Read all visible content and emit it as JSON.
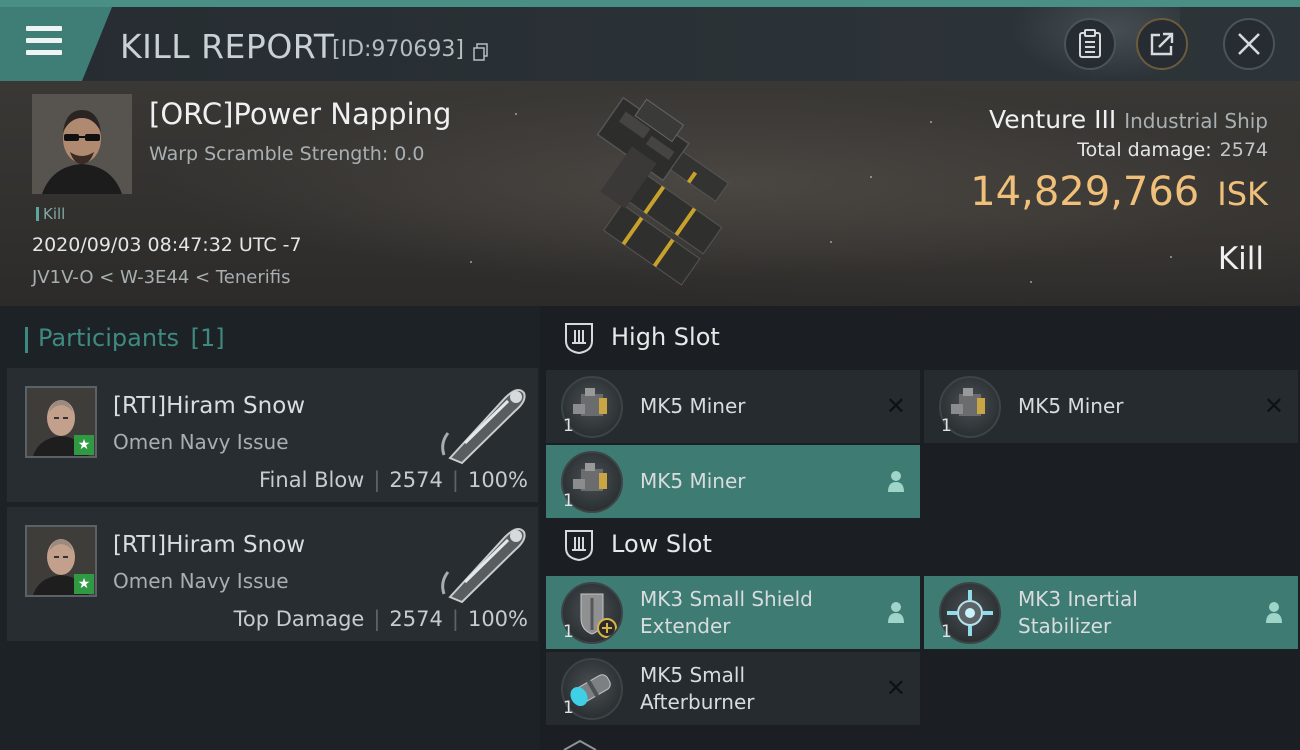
{
  "header": {
    "title": "KILL REPORT",
    "report_id": "[ID:970693]",
    "buttons": [
      "clipboard-icon",
      "share-icon",
      "close-icon"
    ]
  },
  "victim": {
    "name": "[ORC]Power Napping",
    "warp_scramble": "Warp Scramble Strength: 0.0",
    "tag": "Kill",
    "datetime": "2020/09/03 08:47:32 UTC -7",
    "location": "JV1V-O < W-3E44 < Tenerifis"
  },
  "ship": {
    "name": "Venture III",
    "class": "Industrial Ship",
    "total_damage_label": "Total damage:",
    "total_damage": "2574",
    "isk_value": "14,829,766",
    "isk_unit": "ISK",
    "result": "Kill"
  },
  "participants": {
    "label": "Participants",
    "count": "[1]",
    "items": [
      {
        "name": "[RTI]Hiram Snow",
        "ship": "Omen Navy Issue",
        "role": "Final Blow",
        "damage": "2574",
        "percent": "100%"
      },
      {
        "name": "[RTI]Hiram Snow",
        "ship": "Omen Navy Issue",
        "role": "Top Damage",
        "damage": "2574",
        "percent": "100%"
      }
    ]
  },
  "slots": {
    "high": {
      "label": "High Slot",
      "modules": [
        {
          "name": "MK5 Miner",
          "qty": "1",
          "state": "destroyed"
        },
        {
          "name": "MK5 Miner",
          "qty": "1",
          "state": "destroyed"
        },
        {
          "name": "MK5 Miner",
          "qty": "1",
          "state": "dropped"
        }
      ]
    },
    "low": {
      "label": "Low Slot",
      "modules": [
        {
          "name_line1": "MK3 Small Shield",
          "name_line2": "Extender",
          "qty": "1",
          "state": "dropped"
        },
        {
          "name_line1": "MK3 Inertial",
          "name_line2": "Stabilizer",
          "qty": "1",
          "state": "dropped"
        },
        {
          "name_line1": "MK5 Small",
          "name_line2": "Afterburner",
          "qty": "1",
          "state": "destroyed"
        }
      ]
    }
  },
  "colors": {
    "accent_teal": "#3e7b73",
    "isk_gold": "#f0c07a"
  }
}
